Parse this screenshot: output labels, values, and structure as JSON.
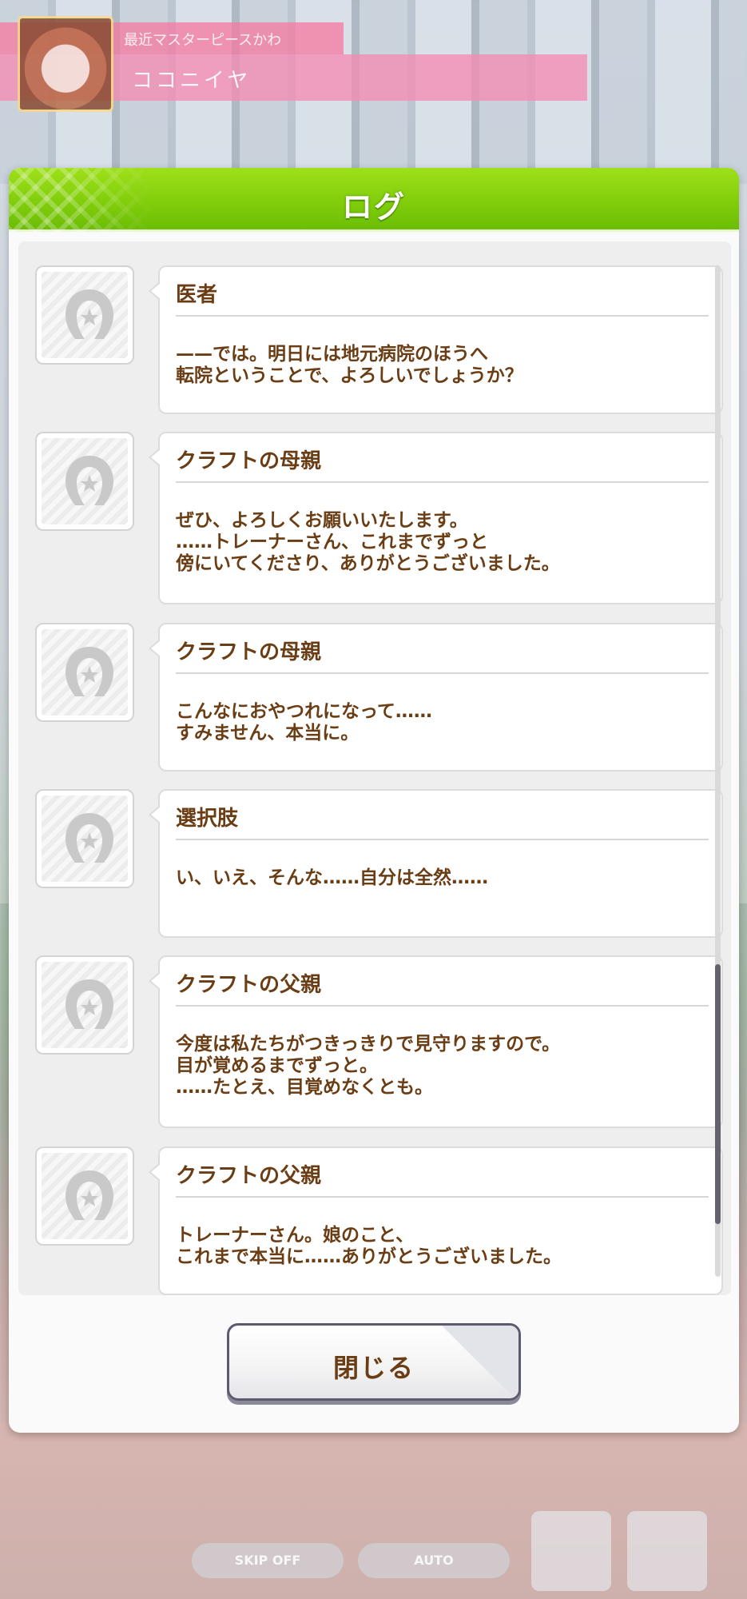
{
  "background": {
    "character_banner": {
      "subtitle": "最近マスターピースかわ",
      "name": "ココニイヤ"
    },
    "bottom_controls": {
      "skip_label": "SKIP OFF",
      "auto_label": "AUTO"
    }
  },
  "dialog": {
    "title": "ログ",
    "close_label": "閉じる",
    "colors": {
      "header_green": "#7fcc0a",
      "text_brown": "#6a3d14"
    },
    "entries": [
      {
        "speaker": "医者",
        "message": "——では。明日には地元病院のほうへ\n転院ということで、よろしいでしょうか？",
        "avatar_icon": "horseshoe-placeholder-icon"
      },
      {
        "speaker": "クラフトの母親",
        "message": "ぜひ、よろしくお願いいたします。\n……トレーナーさん、これまでずっと\n傍にいてくださり、ありがとうございました。",
        "avatar_icon": "horseshoe-placeholder-icon"
      },
      {
        "speaker": "クラフトの母親",
        "message": "こんなにおやつれになって……\nすみません、本当に。",
        "avatar_icon": "horseshoe-placeholder-icon"
      },
      {
        "speaker": "選択肢",
        "message": "い、いえ、そんな……自分は全然……",
        "avatar_icon": "horseshoe-placeholder-icon"
      },
      {
        "speaker": "クラフトの父親",
        "message": "今度は私たちがつきっきりで見守りますので。\n目が覚めるまでずっと。\n……たとえ、目覚めなくとも。",
        "avatar_icon": "horseshoe-placeholder-icon"
      },
      {
        "speaker": "クラフトの父親",
        "message": "トレーナーさん。娘のこと、\nこれまで本当に……ありがとうございました。",
        "avatar_icon": "horseshoe-placeholder-icon"
      }
    ],
    "scroll_position": 0.93
  }
}
